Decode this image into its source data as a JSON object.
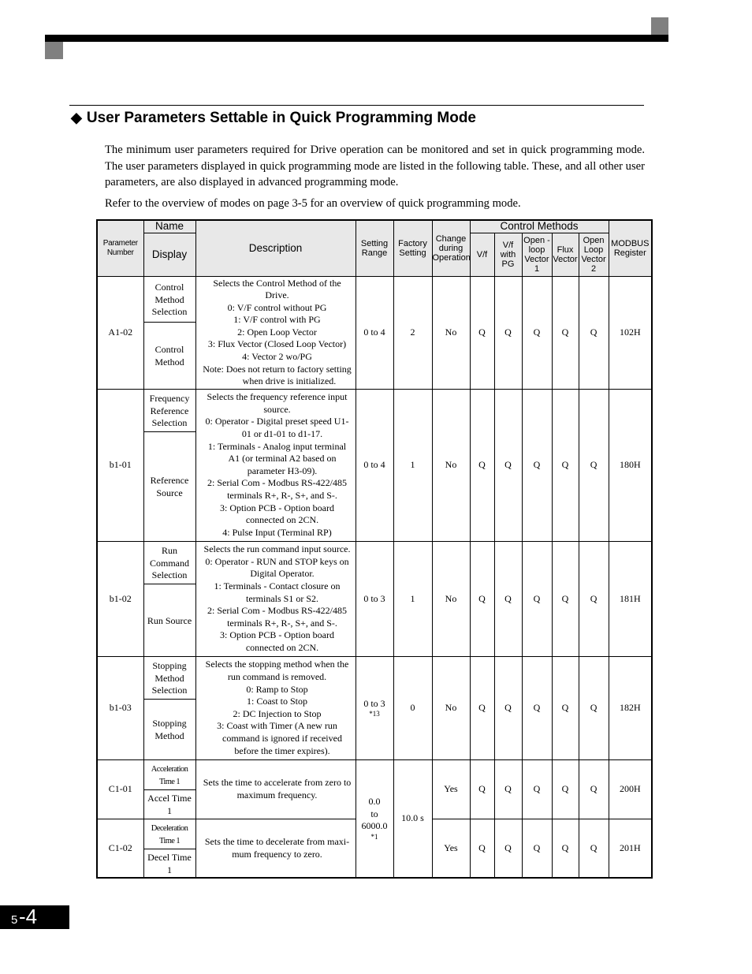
{
  "page": {
    "section_title": "User Parameters Settable in Quick Programming Mode",
    "section_bullet_icon": "diamond",
    "paragraphs": [
      "The minimum user parameters required for Drive operation can be monitored and set in quick programming mode. The user parameters displayed in quick programming mode are listed in the following table. These, and all other user parameters, are also displayed in advanced programming mode.",
      "Refer to the overview of modes on page 3-5 for an overview of quick programming mode."
    ],
    "page_number": {
      "chapter": "5",
      "page": "-4"
    }
  },
  "table": {
    "headers": {
      "parameter_number": "Parameter Number",
      "name": "Name",
      "display": "Display",
      "description": "Description",
      "setting_range": "Setting Range",
      "factory_setting": "Factory Setting",
      "change_during_operation": "Change during Operation",
      "control_methods": "Control Methods",
      "methods": [
        "V/f",
        "V/f with PG",
        "Open -loop Vector 1",
        "Flux Vector",
        "Open Loop Vector 2"
      ],
      "modbus_register": "MODBUS Register"
    },
    "rows": [
      {
        "param": "A1-02",
        "name": "Control Method Selection",
        "display": "Control Method",
        "description": {
          "intro": "Selects the Control Method of the Drive.",
          "items": [
            "0: V/F control without PG",
            "1: V/F control with PG",
            "2: Open Loop Vector",
            "3: Flux Vector (Closed Loop Vector)",
            "4: Vector 2 wo/PG"
          ],
          "note": "Note: Does not return to factory setting when drive is initialized."
        },
        "range": "0 to 4",
        "range_note": "",
        "factory": "2",
        "change": "No",
        "methods": [
          "Q",
          "Q",
          "Q",
          "Q",
          "Q"
        ],
        "modbus": "102H"
      },
      {
        "param": "b1-01",
        "name": "Frequency Reference Selection",
        "display": "Reference Source",
        "description": {
          "intro": "Selects the frequency reference input source.",
          "items": [
            "0: Operator - Digital preset speed U1-01 or d1-01 to d1-17.",
            "1: Terminals - Analog input terminal A1 (or terminal A2 based on parameter H3-09).",
            "2: Serial Com - Modbus RS-422/485 terminals R+, R-, S+, and S-.",
            "3: Option PCB - Option board connected on 2CN.",
            "4: Pulse Input (Terminal RP)"
          ],
          "note": ""
        },
        "range": "0 to 4",
        "range_note": "",
        "factory": "1",
        "change": "No",
        "methods": [
          "Q",
          "Q",
          "Q",
          "Q",
          "Q"
        ],
        "modbus": "180H"
      },
      {
        "param": "b1-02",
        "name": "Run Command Selection",
        "display": "Run Source",
        "description": {
          "intro": "Selects the run command input source.",
          "items": [
            "0: Operator - RUN and STOP keys on Digital Operator.",
            "1: Terminals - Contact closure on terminals S1 or S2.",
            "2: Serial Com - Modbus RS-422/485 terminals R+, R-, S+, and S-.",
            "3: Option PCB - Option board connected on 2CN."
          ],
          "note": ""
        },
        "range": "0 to 3",
        "range_note": "",
        "factory": "1",
        "change": "No",
        "methods": [
          "Q",
          "Q",
          "Q",
          "Q",
          "Q"
        ],
        "modbus": "181H"
      },
      {
        "param": "b1-03",
        "name": "Stopping Method Selection",
        "display": "Stopping Method",
        "description": {
          "intro": "Selects the stopping method when the run command is removed.",
          "items": [
            "0: Ramp to Stop",
            "1: Coast to Stop",
            "2: DC Injection to Stop",
            "3: Coast with Timer (A new run command is ignored if received before the timer expires)."
          ],
          "note": ""
        },
        "range": "0 to 3",
        "range_note": "*13",
        "factory": "0",
        "change": "No",
        "methods": [
          "Q",
          "Q",
          "Q",
          "Q",
          "Q"
        ],
        "modbus": "182H"
      },
      {
        "param": "C1-01",
        "name": "Acceleration Time 1",
        "display": "Accel Time 1",
        "description": {
          "intro": "Sets the time to accelerate from zero to maximum frequency.",
          "items": [],
          "note": ""
        },
        "change": "Yes",
        "methods": [
          "Q",
          "Q",
          "Q",
          "Q",
          "Q"
        ],
        "modbus": "200H"
      },
      {
        "param": "C1-02",
        "name": "Deceleration Time 1",
        "display": "Decel Time 1",
        "description": {
          "intro": "Sets the time to decelerate from maxi-mum frequency to zero.",
          "items": [],
          "note": ""
        },
        "change": "Yes",
        "methods": [
          "Q",
          "Q",
          "Q",
          "Q",
          "Q"
        ],
        "modbus": "201H"
      }
    ],
    "shared_c1": {
      "range": [
        "0.0",
        "to",
        "6000.0"
      ],
      "range_note": "*1",
      "factory": "10.0 s"
    }
  }
}
